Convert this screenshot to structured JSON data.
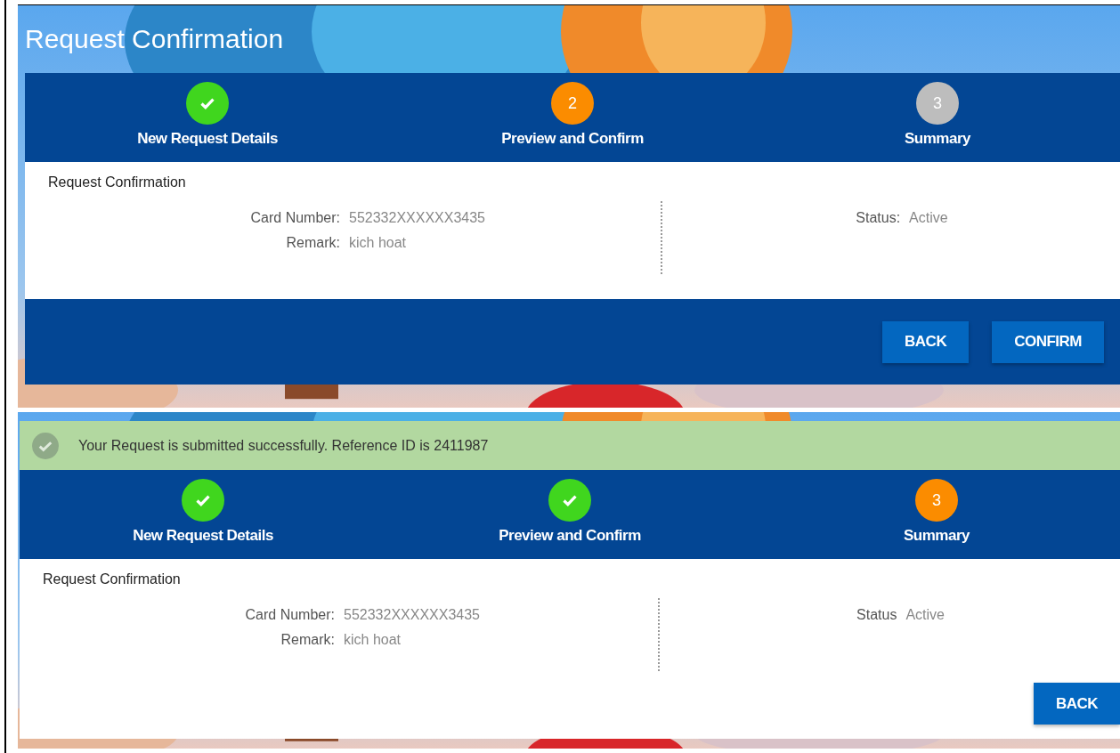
{
  "screens": [
    {
      "title": "Request Confirmation",
      "steps": [
        {
          "label": "New Request Details",
          "done": true,
          "selected": false
        },
        {
          "label": "Preview and Confirm",
          "number": "2",
          "done": false,
          "selected": true
        },
        {
          "label": "Summary",
          "number": "3",
          "done": false,
          "selected": false
        }
      ],
      "section_title": "Request Confirmation",
      "fields_left": [
        {
          "label": "Card Number:",
          "value": "552332XXXXXX3435"
        },
        {
          "label": "Remark:",
          "value": "kich hoat"
        }
      ],
      "fields_right": [
        {
          "label": "Status:",
          "value": "Active"
        }
      ],
      "footer_bar": true,
      "buttons": [
        "BACK",
        "CONFIRM"
      ]
    },
    {
      "alert": "Your Request is submitted successfully. Reference ID is 2411987",
      "steps": [
        {
          "label": "New Request Details",
          "done": true,
          "selected": false
        },
        {
          "label": "Preview and Confirm",
          "done": true,
          "selected": false
        },
        {
          "label": "Summary",
          "number": "3",
          "done": false,
          "selected": true
        }
      ],
      "section_title": "Request Confirmation",
      "fields_left": [
        {
          "label": "Card Number:",
          "value": "552332XXXXXX3435"
        },
        {
          "label": "Remark:",
          "value": "kich hoat"
        }
      ],
      "fields_right": [
        {
          "label": "Status",
          "value": "Active"
        }
      ],
      "footer_bar": false,
      "buttons": [
        "BACK"
      ]
    }
  ]
}
